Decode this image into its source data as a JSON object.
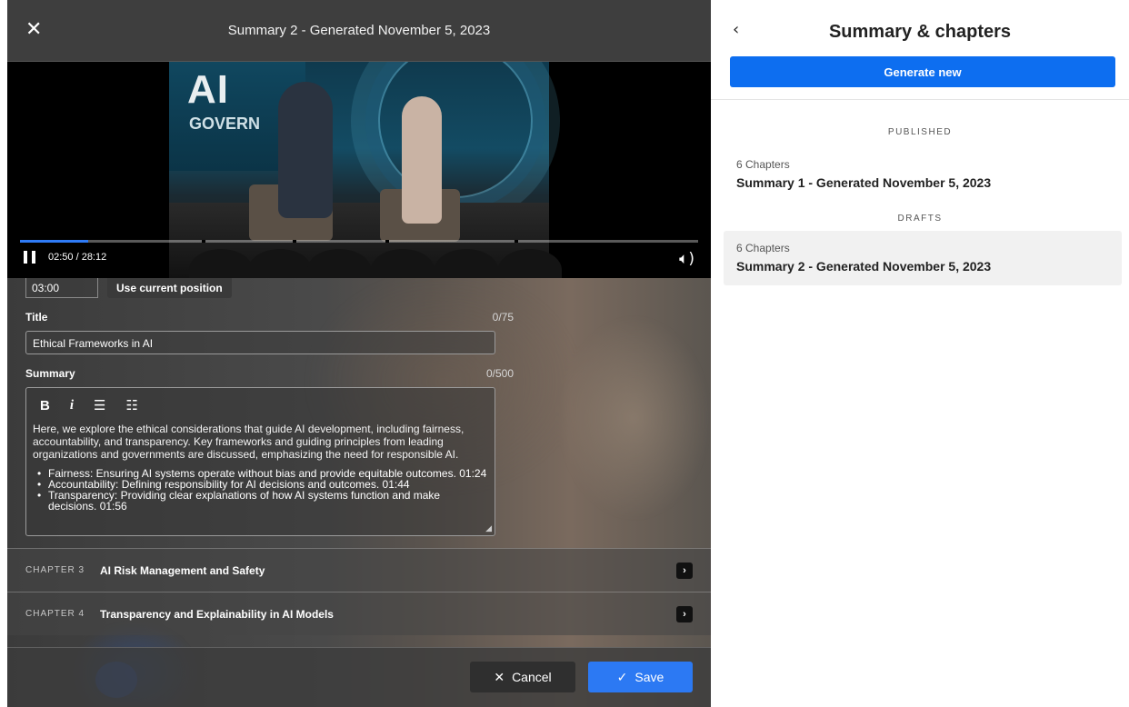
{
  "editor": {
    "title": "Summary 2 - Generated November 5, 2023",
    "video": {
      "time_display": "02:50 / 28:12",
      "progress": 0.1,
      "sign_line1": "AI",
      "sign_line2": "GOVERN"
    },
    "form": {
      "start_time_value": "03:00",
      "use_current_label": "Use current position",
      "title_label": "Title",
      "title_count": "0/75",
      "title_value": "Ethical Frameworks in AI",
      "summary_label": "Summary",
      "summary_count": "0/500",
      "toolbar": {
        "bold": "B",
        "italic": "i",
        "bullets": "☰",
        "numbered": "☷"
      },
      "summary_text": "Here, we explore the ethical considerations that guide AI development, including fairness, accountability, and transparency. Key frameworks and guiding principles from leading organizations and governments are discussed, emphasizing the need for responsible AI.",
      "bullets": [
        "Fairness: Ensuring AI systems operate without bias and provide equitable outcomes. 01:24",
        "Accountability: Defining responsibility for AI decisions and outcomes. 01:44",
        "Transparency: Providing clear explanations of how AI systems function and make decisions. 01:56"
      ]
    },
    "chapters": [
      {
        "label": "CHAPTER 3",
        "name": "AI Risk Management and Safety"
      },
      {
        "label": "CHAPTER 4",
        "name": "Transparency and Explainability in AI Models"
      }
    ],
    "footer": {
      "cancel_label": "Cancel",
      "save_label": "Save"
    }
  },
  "side": {
    "title": "Summary & chapters",
    "generate_label": "Generate new",
    "published_label": "PUBLISHED",
    "drafts_label": "DRAFTS",
    "published": [
      {
        "chapters": "6 Chapters",
        "name": "Summary 1 - Generated November 5, 2023"
      }
    ],
    "drafts": [
      {
        "chapters": "6 Chapters",
        "name": "Summary 2 - Generated November 5, 2023"
      }
    ]
  },
  "colors": {
    "accent": "#0d6ef0",
    "save": "#2c79f3",
    "progress": "#2f7bf6"
  },
  "icons": {
    "close": "close-icon",
    "pause": "pause-icon",
    "volume": "volume-icon",
    "back": "chevron-left-icon",
    "chapter_arrow": "chevron-right-icon",
    "check": "check-icon"
  }
}
